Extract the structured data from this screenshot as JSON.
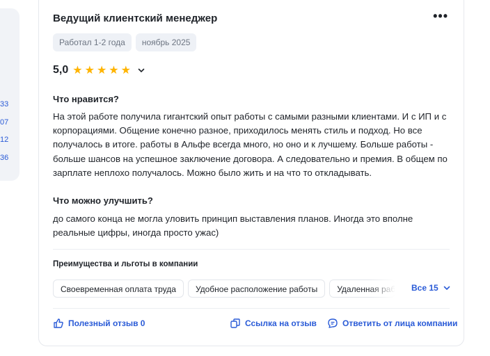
{
  "sidebar": {
    "numbers": [
      "33",
      "07",
      "12",
      "36"
    ]
  },
  "review": {
    "title": "Ведущий клиентский менеджер",
    "tags": [
      "Работал 1-2 года",
      "ноябрь 2025"
    ],
    "rating": "5,0",
    "stars": "★★★★★",
    "likes_heading": "Что нравится?",
    "likes_text": "На этой работе получила гигантский опыт работы с самыми разными клиентами. И с ИП и с корпорациями. Общение конечно разное, приходилось менять стиль и подход. Но все получалось в итоге. работы в Альфе всегда много, но оно и к лучшему. Больше работы - больше шансов на успешное заключение договора. А следовательно и премия. В общем по зарплате неплохо получалось. Можно было жить и на что то откладывать.",
    "improve_heading": "Что можно улучшить?",
    "improve_text": "до самого конца не могла уловить принцип выставления планов. Иногда это вполне реальные цифры, иногда просто ужас)",
    "benefits_title": "Преимущества и льготы в компании",
    "benefits": [
      "Своевременная оплата труда",
      "Удобное расположение работы",
      "Удаленная работа"
    ],
    "benefits_all": "Все 15",
    "actions": {
      "helpful": "Полезный отзыв 0",
      "link": "Ссылка на отзыв",
      "reply": "Ответить от лица компании"
    }
  },
  "colors": {
    "accent": "#2a5bd7",
    "star": "#ffb400",
    "tag_bg": "#eef1f6"
  }
}
